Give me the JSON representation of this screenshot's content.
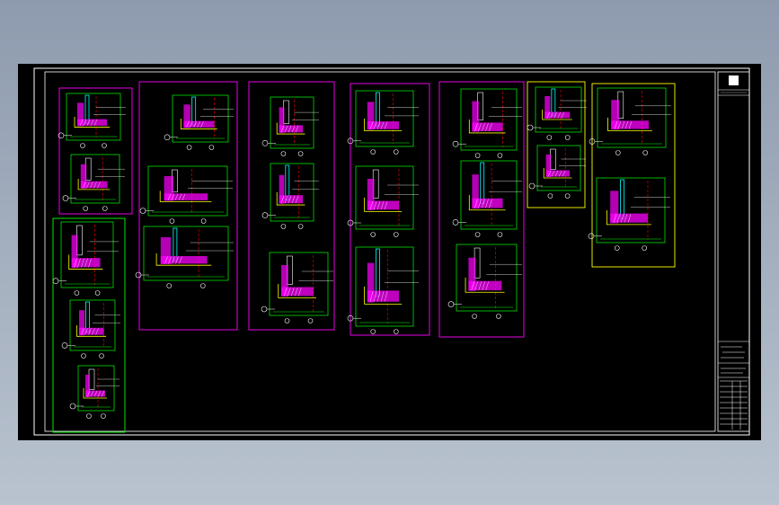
{
  "window": {
    "background_top": "#8e9bae",
    "background_bottom": "#bac4d0"
  },
  "drawing": {
    "canvas_color": "#000000",
    "frame_color": "#ffffff",
    "title_block_color": "#ffffff"
  },
  "groups": [
    {
      "id": "g1",
      "border_color": "#ff00ff",
      "detail_count": 2
    },
    {
      "id": "g2",
      "border_color": "#00ff00",
      "detail_count": 3
    },
    {
      "id": "g3",
      "border_color": "#ff00ff",
      "detail_count": 3
    },
    {
      "id": "g4",
      "border_color": "#ff00ff",
      "detail_count": 3
    },
    {
      "id": "g5",
      "border_color": "#ff00ff",
      "detail_count": 3
    },
    {
      "id": "g6",
      "border_color": "#ff00ff",
      "detail_count": 3
    },
    {
      "id": "g7",
      "border_color": "#ffff00",
      "detail_count": 2
    },
    {
      "id": "g8",
      "border_color": "#ffff00",
      "detail_count": 2
    }
  ],
  "palette": {
    "detail_border": "#00ff00",
    "wall_fill": "#ff00ff",
    "insulation": "#ffff00",
    "glass": "#00ffff",
    "axis_line": "#ff0000",
    "leader": "#ffffff",
    "dimension": "#00ff00"
  },
  "icons": [
    "title-block-logo-icon",
    "grid-bubble-icon"
  ]
}
